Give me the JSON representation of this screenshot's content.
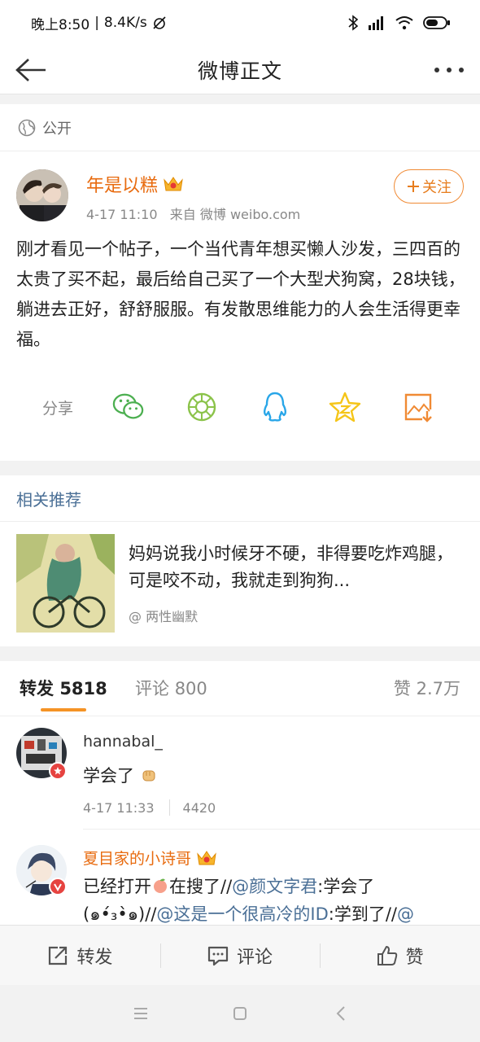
{
  "status_bar": {
    "time": "晚上8:50",
    "speed": "8.4K/s",
    "battery_icon": "battery-icon"
  },
  "nav": {
    "title": "微博正文"
  },
  "post": {
    "visibility": "公开",
    "author": "年是以糕",
    "follow_label": "关注",
    "time": "4-17 11:10",
    "source": "来自 微博 weibo.com",
    "text": "刚才看见一个帖子，一个当代青年想买懒人沙发，三四百的太贵了买不起，最后给自己买了一个大型犬狗窝，28块钱，躺进去正好，舒舒服服。有发散思维能力的人会生活得更幸福。",
    "share_label": "分享",
    "share_targets": [
      "wechat-icon",
      "moments-icon",
      "qq-icon",
      "qzone-icon",
      "save-image-icon"
    ]
  },
  "recommend": {
    "title": "相关推荐",
    "text": "妈妈说我小时候牙不硬，非得要吃炸鸡腿，可是咬不动，我就走到狗狗...",
    "source": "@ 两性幽默"
  },
  "tabs": {
    "repost_label": "转发",
    "repost_count": "5818",
    "comment_label": "评论",
    "comment_count": "800",
    "like_label": "赞",
    "like_count": "2.7万"
  },
  "reposts": [
    {
      "name": "hannabal_",
      "text": "学会了",
      "emoji": "fist-emoji",
      "time": "4-17 11:33",
      "likes": "4420"
    },
    {
      "name": "夏目家的小诗哥",
      "text_prefix": "已经打开",
      "emoji": "peach-emoji",
      "text_mid": "在搜了//",
      "mention1": "@颜文字君",
      "text_mid2": ":学会了",
      "kaomoji": "(๑•́₃•̀๑)//",
      "mention2": "@这是一个很高冷的ID",
      "text_end": ":学到了//",
      "mention3": "@"
    }
  ],
  "actions": {
    "repost": "转发",
    "comment": "评论",
    "like": "赞"
  },
  "colors": {
    "orange": "#e86b0f",
    "link": "#4a6f96",
    "accent": "#f59325"
  }
}
